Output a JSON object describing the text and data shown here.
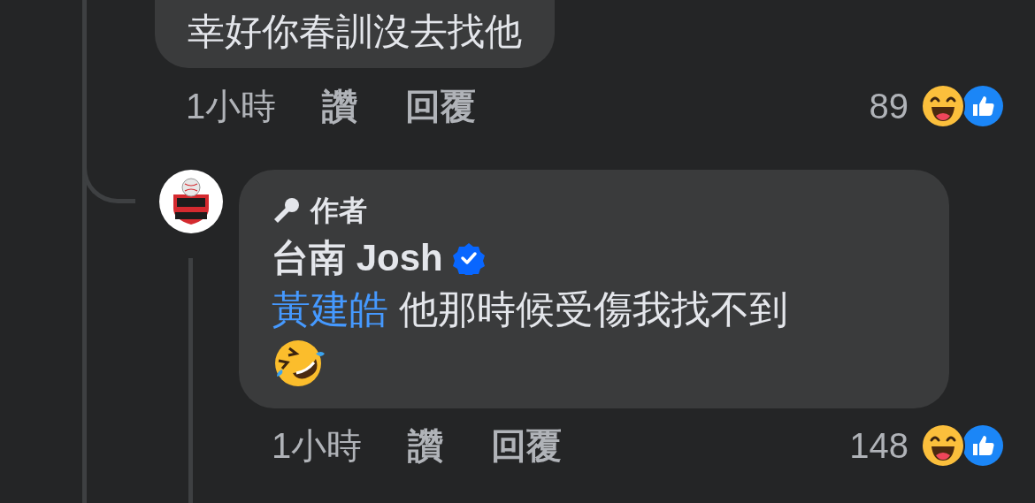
{
  "comments": [
    {
      "text": "幸好你春訓沒去找他",
      "time": "1小時",
      "like": "讚",
      "reply": "回覆",
      "reaction_count": "89"
    },
    {
      "author_badge": "作者",
      "author": "台南 Josh",
      "verified": true,
      "mention": "黃建皓",
      "text": "他那時候受傷我找不到",
      "time": "1小時",
      "like": "讚",
      "reply": "回覆",
      "reaction_count": "148"
    }
  ]
}
